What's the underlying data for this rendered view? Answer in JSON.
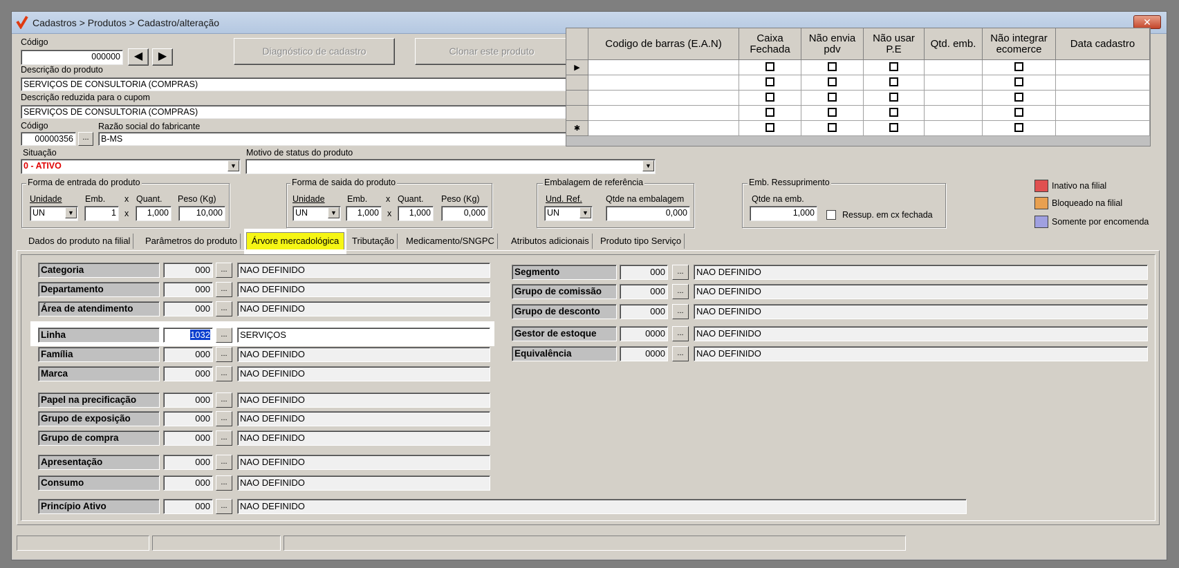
{
  "window": {
    "title": "Cadastros > Produtos > Cadastro/alteração",
    "close": "✕"
  },
  "codigo": {
    "label": "Código",
    "value": "000000"
  },
  "buttons": {
    "prev": "◀",
    "next": "▶",
    "diagnostico": "Diagnóstico de cadastro",
    "clonar": "Clonar este produto"
  },
  "descricao": {
    "label": "Descrição do produto",
    "value": "SERVIÇOS DE CONSULTORIA (COMPRAS)"
  },
  "descricao_reduzida": {
    "label": "Descrição reduzida para o cupom",
    "value": "SERVIÇOS DE CONSULTORIA (COMPRAS)"
  },
  "fabricante": {
    "code_label": "Código",
    "code_value": "00000356",
    "lookup": "...",
    "name_label": "Razão social do fabricante",
    "name_value": "B-MS"
  },
  "situacao": {
    "label": "Situação",
    "value": "0 - ATIVO",
    "color": "#e00000"
  },
  "motivo": {
    "label": "Motivo de status do produto",
    "value": ""
  },
  "ean_grid": {
    "headers": [
      "Codigo de barras (E.A.N)",
      "Caixa Fechada",
      "Não envia pdv",
      "Não usar P.E",
      "Qtd. emb.",
      "Não integrar ecomerce",
      "Data cadastro"
    ],
    "row_indicators": [
      "▶",
      "",
      "",
      "",
      "✱"
    ]
  },
  "entrada": {
    "title": "Forma de entrada do produto",
    "unidade_label": "Unidade",
    "emb_label": "Emb.",
    "quant_label": "Quant.",
    "peso_label": "Peso (Kg)",
    "unidade": "UN",
    "emb": "1",
    "quant": "1,000",
    "peso": "10,000",
    "x": "x"
  },
  "saida": {
    "title": "Forma de saida do produto",
    "unidade_label": "Unidade",
    "emb_label": "Emb.",
    "quant_label": "Quant.",
    "peso_label": "Peso (Kg)",
    "unidade": "UN",
    "emb": "1,000",
    "quant": "1,000",
    "peso": "0,000",
    "x": "x"
  },
  "embalagem": {
    "title": "Embalagem de referência",
    "und_label": "Und. Ref.",
    "qtde_label": "Qtde na embalagem",
    "und": "UN",
    "qtde": "0,000"
  },
  "ressup": {
    "title": "Emb. Ressuprimento",
    "qtde_label": "Qtde na emb.",
    "qtde": "1,000",
    "check_label": "Ressup. em cx fechada"
  },
  "legend": [
    {
      "label": "Inativo na filial",
      "color": "#e05050"
    },
    {
      "label": "Bloqueado na filial",
      "color": "#e8a050"
    },
    {
      "label": "Somente por encomenda",
      "color": "#a0a0e0"
    }
  ],
  "tabs": [
    "Dados do produto na filial",
    "Parâmetros do produto",
    "Árvore mercadológica",
    "Tributação",
    "Medicamento/SNGPC",
    "Atributos adicionais",
    "Produto tipo Serviço"
  ],
  "tree_left": [
    {
      "label": "Categoria",
      "code": "000",
      "desc": "NAO DEFINIDO"
    },
    {
      "label": "Departamento",
      "code": "000",
      "desc": "NAO DEFINIDO"
    },
    {
      "label": "Área de atendimento",
      "code": "000",
      "desc": "NAO DEFINIDO"
    },
    {
      "label": "Linha",
      "code": "1032",
      "desc": "SERVIÇOS"
    },
    {
      "label": "Família",
      "code": "000",
      "desc": "NAO DEFINIDO"
    },
    {
      "label": "Marca",
      "code": "000",
      "desc": "NAO DEFINIDO"
    },
    {
      "label": "Papel na precificação",
      "code": "000",
      "desc": "NAO DEFINIDO"
    },
    {
      "label": "Grupo de exposição",
      "code": "000",
      "desc": "NAO DEFINIDO"
    },
    {
      "label": "Grupo de compra",
      "code": "000",
      "desc": "NAO DEFINIDO"
    },
    {
      "label": "Apresentação",
      "code": "000",
      "desc": "NAO DEFINIDO"
    },
    {
      "label": "Consumo",
      "code": "000",
      "desc": "NAO DEFINIDO"
    },
    {
      "label": "Princípio Ativo",
      "code": "000",
      "desc": "NAO DEFINIDO"
    }
  ],
  "tree_right": [
    {
      "label": "Segmento",
      "code": "000",
      "desc": "NAO DEFINIDO"
    },
    {
      "label": "Grupo de comissão",
      "code": "000",
      "desc": "NAO DEFINIDO"
    },
    {
      "label": "Grupo de desconto",
      "code": "000",
      "desc": "NAO DEFINIDO"
    },
    {
      "label": "Gestor de estoque",
      "code": "0000",
      "desc": "NAO DEFINIDO"
    },
    {
      "label": "Equivalência",
      "code": "0000",
      "desc": "NAO DEFINIDO"
    }
  ],
  "lookup": "...",
  "combo_arrow": "▼"
}
